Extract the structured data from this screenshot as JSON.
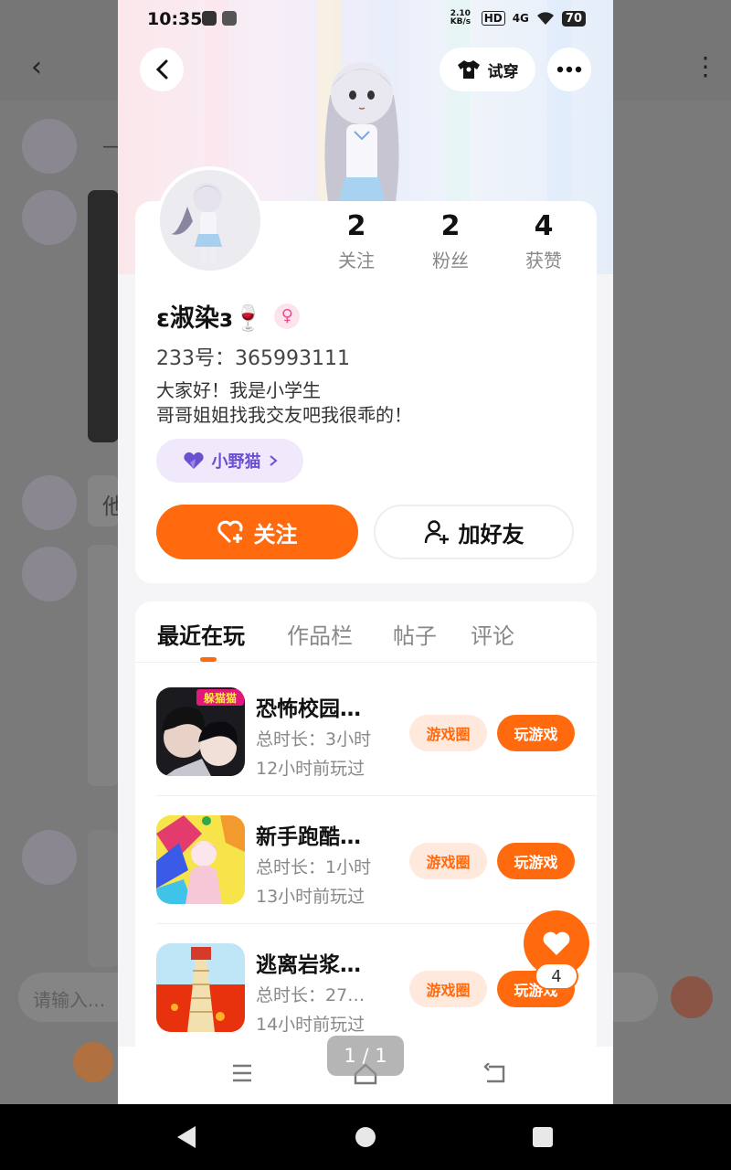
{
  "status_bar": {
    "time": "10:35",
    "net_speed": "2.10 KB/s",
    "hd": "HD",
    "signal": "4G",
    "battery": "70"
  },
  "header": {
    "try_on_label": "试穿"
  },
  "profile": {
    "stats": [
      {
        "value": "2",
        "label": "关注"
      },
      {
        "value": "2",
        "label": "粉丝"
      },
      {
        "value": "4",
        "label": "获赞"
      }
    ],
    "nickname": "ɛ淑染ɜ🍷",
    "gender_symbol": "♀",
    "uid": "233号：365993111",
    "bio_line1": "大家好！我是小学生",
    "bio_line2": "哥哥姐姐找我交友吧我很乖的！",
    "tag_label": "小野猫",
    "follow_label": "关注",
    "add_friend_label": "加好友"
  },
  "tabs": [
    {
      "label": "最近在玩"
    },
    {
      "label": "作品栏"
    },
    {
      "label": "帖子"
    },
    {
      "label": "评论"
    }
  ],
  "games": [
    {
      "name": "恐怖校园…",
      "duration": "总时长：3小时",
      "last_played": "12小时前玩过",
      "thumb_badge": "躲猫猫"
    },
    {
      "name": "新手跑酷…",
      "duration": "总时长：1小时",
      "last_played": "13小时前玩过",
      "thumb_badge": ""
    },
    {
      "name": "逃离岩浆…",
      "duration": "总时长：27…",
      "last_played": "14小时前玩过",
      "thumb_badge": ""
    }
  ],
  "game_actions": {
    "circle_label": "游戏圈",
    "play_label": "玩游戏"
  },
  "fab": {
    "like_count": "4"
  },
  "pager": {
    "indicator": "1 / 1"
  },
  "background_app": {
    "input_placeholder": "请输入...",
    "snippet1": "他",
    "snippet2": "—"
  },
  "colors": {
    "accent": "#ff6a0f",
    "tag_purple": "#6b4fd1"
  }
}
